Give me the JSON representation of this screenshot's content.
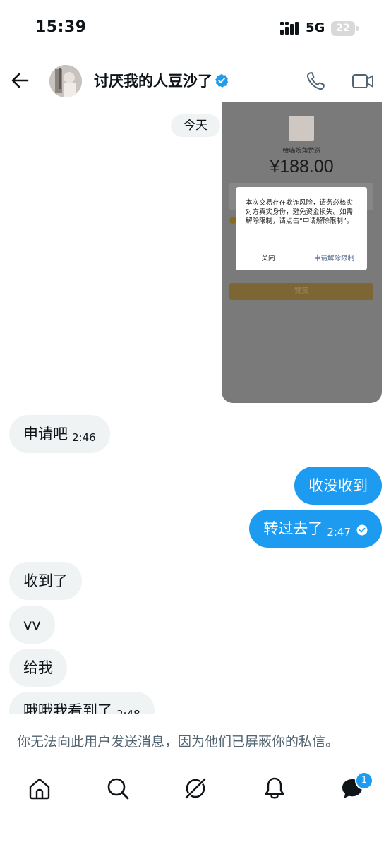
{
  "status_bar": {
    "time": "15:39",
    "network": "5G",
    "battery": "22"
  },
  "header": {
    "name": "讨厌我的人豆沙了",
    "verified": true,
    "icons": [
      "back-arrow-icon",
      "phone-icon",
      "video-call-icon",
      "verified-badge-icon"
    ]
  },
  "chat": {
    "date_label": "今天",
    "shared_image": {
      "caption": "给喵婉角赞赏",
      "amount": "¥188.00",
      "dialog_text": "本次交易存在欺诈风险，请务必核实对方真实身份，避免资金损失。如需解除限制，请点击“申请解除限制”。",
      "dialog_close": "关闭",
      "dialog_apply": "申请解除限制",
      "reward_button": "赞赏"
    },
    "messages": [
      {
        "direction": "in",
        "text": "申请吧",
        "time": "2:46"
      },
      {
        "direction": "out",
        "text": "收没收到",
        "time": ""
      },
      {
        "direction": "out",
        "text": "转过去了",
        "time": "2:47",
        "sent": true
      },
      {
        "direction": "in",
        "text": "收到了",
        "time": ""
      },
      {
        "direction": "in",
        "text": "vv",
        "time": ""
      },
      {
        "direction": "in",
        "text": "给我",
        "time": ""
      },
      {
        "direction": "in",
        "text": "哦哦我看到了",
        "time": "2:48"
      }
    ]
  },
  "notice": {
    "text": "你无法向此用户发送消息，因为他们已屏蔽你的私信。"
  },
  "bottom_nav": {
    "items": [
      "home-icon",
      "search-icon",
      "grok-icon",
      "notifications-icon",
      "messages-icon"
    ],
    "messages_badge": "1"
  },
  "colors": {
    "accent": "#1d9bf0",
    "incoming_bubble": "#eff3f4",
    "muted_text": "#536471"
  }
}
